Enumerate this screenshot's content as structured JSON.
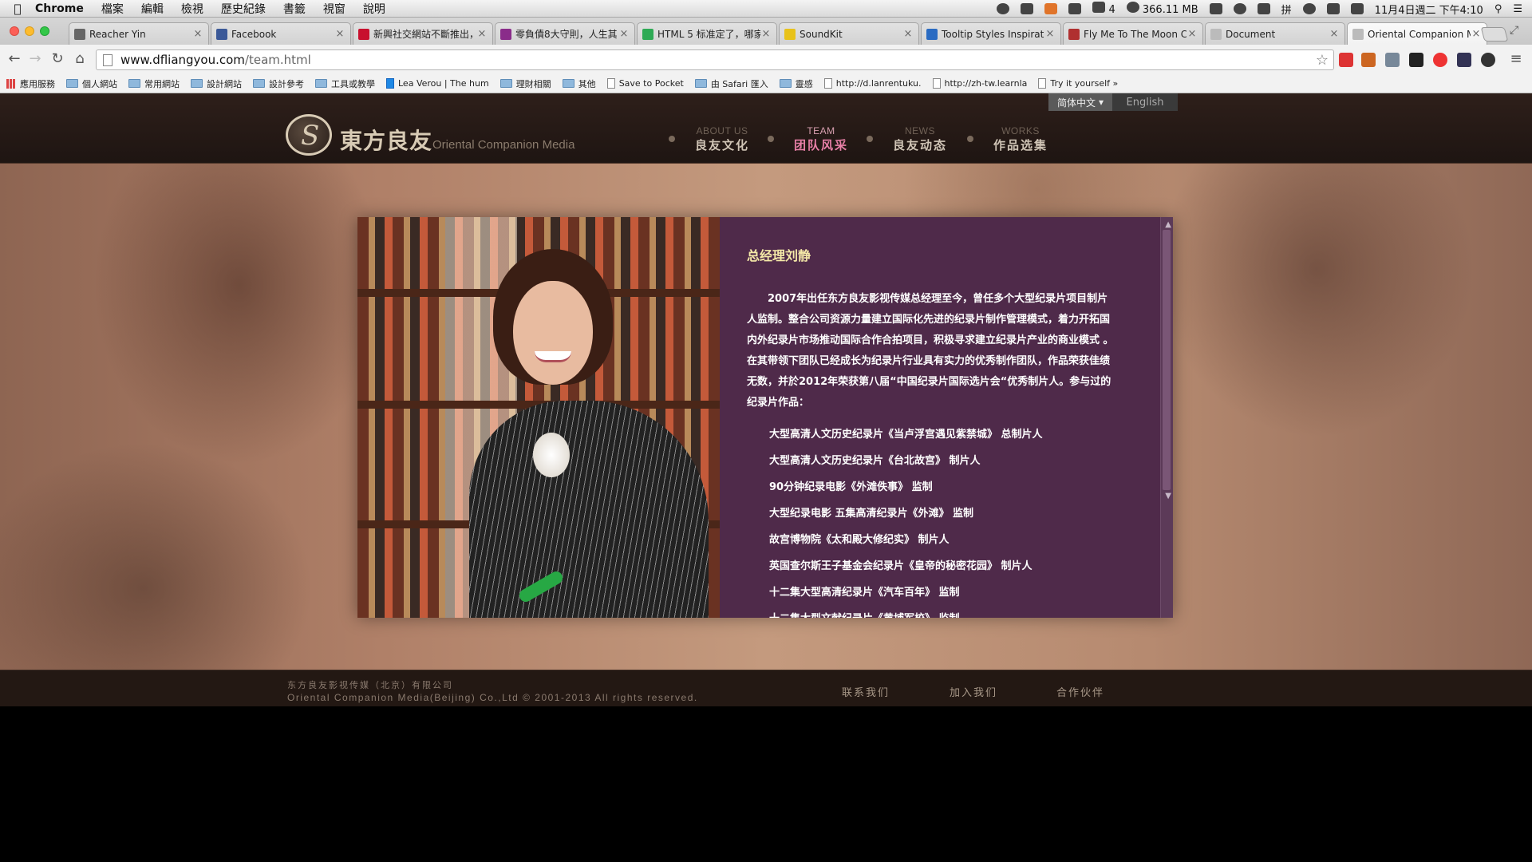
{
  "menubar": {
    "app": "Chrome",
    "items": [
      "檔案",
      "編輯",
      "檢視",
      "歷史紀錄",
      "書籤",
      "視窗",
      "說明"
    ],
    "status_a4": "4",
    "memory": "366.11 MB",
    "ime": "拼",
    "clock": "11月4日週二 下午4:10"
  },
  "tabs": [
    {
      "title": "Reacher Yin",
      "color": "#666666"
    },
    {
      "title": "Facebook",
      "color": "#3b5998"
    },
    {
      "title": "新興社交網站不斷推出，",
      "color": "#c8102e"
    },
    {
      "title": "零負債8大守則，人生其",
      "color": "#8a2c8a"
    },
    {
      "title": "HTML 5 标准定了，哪家",
      "color": "#2eaa55"
    },
    {
      "title": "SoundKit",
      "color": "#e8c21a"
    },
    {
      "title": "Tooltip Styles Inspiratio",
      "color": "#2a6bc2"
    },
    {
      "title": "Fly Me To The Moon Ch",
      "color": "#b03030"
    },
    {
      "title": "Document",
      "color": "#bbbbbb"
    },
    {
      "title": "Oriental Companion Me",
      "color": "#bbbbbb"
    }
  ],
  "address": {
    "domain": "www.dfliangyou.com",
    "path": "/team.html"
  },
  "bookmarks": [
    {
      "label": "應用服務",
      "kind": "apps"
    },
    {
      "label": "個人網站",
      "kind": "folder"
    },
    {
      "label": "常用網站",
      "kind": "folder"
    },
    {
      "label": "設計網站",
      "kind": "folder"
    },
    {
      "label": "設計參考",
      "kind": "folder"
    },
    {
      "label": "工具或教學",
      "kind": "folder"
    },
    {
      "label": "Lea Verou | The hum",
      "kind": "site"
    },
    {
      "label": "理財相關",
      "kind": "folder"
    },
    {
      "label": "其他",
      "kind": "folder"
    },
    {
      "label": "Save to Pocket",
      "kind": "doc"
    },
    {
      "label": "由 Safari 匯入",
      "kind": "folder"
    },
    {
      "label": "靈感",
      "kind": "folder"
    },
    {
      "label": "http://d.lanrentuku.",
      "kind": "doc"
    },
    {
      "label": "http://zh-tw.learnla",
      "kind": "doc"
    },
    {
      "label": "Try it yourself »",
      "kind": "doc"
    }
  ],
  "site": {
    "lang_current": "简体中文",
    "lang_other": "English",
    "logo_cn": "東方良友",
    "logo_en": "Oriental Companion Media",
    "nav": [
      {
        "en": "ABOUT US",
        "cn": "良友文化",
        "active": false
      },
      {
        "en": "TEAM",
        "cn": "团队风采",
        "active": true
      },
      {
        "en": "NEWS",
        "cn": "良友动态",
        "active": false
      },
      {
        "en": "WORKS",
        "cn": "作品选集",
        "active": false
      }
    ],
    "bio_title": "总经理刘静",
    "bio_body": "2007年出任东方良友影视传媒总经理至今，曾任多个大型纪录片项目制片人监制。整合公司资源力量建立国际化先进的纪录片制作管理模式，着力开拓国内外纪录片市场推动国际合作合拍项目，积极寻求建立纪录片产业的商业模式 。在其带领下团队已经成长为纪录片行业具有实力的优秀制作团队，作品荣获佳绩无数，并於2012年荣获第八届“中国纪录片国际选片会“优秀制片人。参与过的纪录片作品：",
    "works": [
      "大型高清人文历史纪录片《当卢浮宫遇见紫禁城》 总制片人",
      "大型高清人文历史纪录片《台北故宫》 制片人",
      "90分钟纪录电影《外滩佚事》 监制",
      "大型纪录电影 五集高清纪录片《外滩》 监制",
      "故宫博物院《太和殿大修纪实》 制片人",
      "英国查尔斯王子基金会纪录片《皇帝的秘密花园》 制片人",
      "十二集大型高清纪录片《汽车百年》 监制",
      "十二集大型文献纪录片《黄埔军校》 监制"
    ],
    "footer_cn": "东方良友影视传媒（北京）有限公司",
    "footer_en": "Oriental Companion Media(Beijing) Co.,Ltd © 2001-2013 All rights reserved.",
    "footer_links": [
      "联系我们",
      "加入我们",
      "合作伙伴"
    ]
  }
}
